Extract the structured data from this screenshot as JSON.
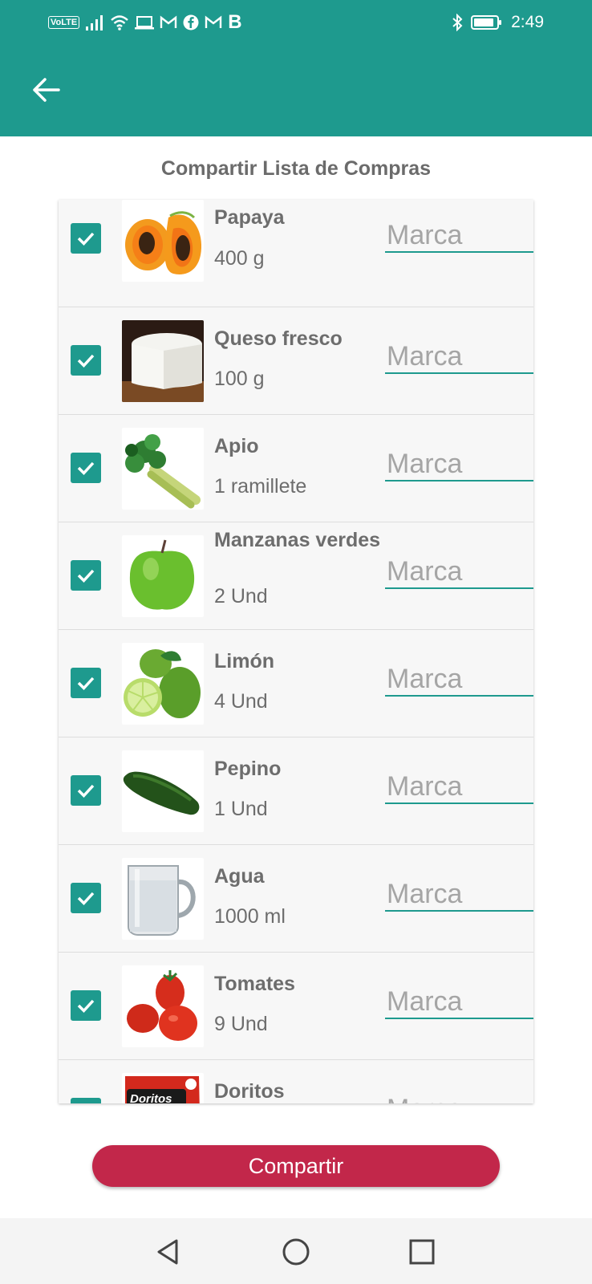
{
  "status_bar": {
    "volte": "VoLTE",
    "carrier_letter": "B",
    "time": "2:49",
    "icons_left": [
      "signal-icon",
      "wifi-icon",
      "laptop-icon",
      "gmail-icon",
      "facebook-icon",
      "gmail-icon",
      "b-app-icon"
    ],
    "icons_right": [
      "bluetooth-icon",
      "battery-icon"
    ]
  },
  "app_bar": {
    "back_icon": "back-arrow-icon",
    "color": "#1e9a8e"
  },
  "page": {
    "title": "Compartir Lista de Compras"
  },
  "colors": {
    "accent": "#1e9a8e",
    "share_button": "#c2274a",
    "text": "#6d6d6d"
  },
  "items": [
    {
      "name": "Papaya",
      "quantity": "400 g",
      "checked": true,
      "brand_placeholder": "Marca",
      "image": "papaya-image"
    },
    {
      "name": "Queso fresco",
      "quantity": "100 g",
      "checked": true,
      "brand_placeholder": "Marca",
      "image": "cheese-image"
    },
    {
      "name": "Apio",
      "quantity": "1 ramillete",
      "checked": true,
      "brand_placeholder": "Marca",
      "image": "celery-image"
    },
    {
      "name": "Manzanas verdes",
      "quantity": "2 Und",
      "checked": true,
      "brand_placeholder": "Marca",
      "image": "green-apple-image"
    },
    {
      "name": "Limón",
      "quantity": "4 Und",
      "checked": true,
      "brand_placeholder": "Marca",
      "image": "lime-image"
    },
    {
      "name": "Pepino",
      "quantity": "1 Und",
      "checked": true,
      "brand_placeholder": "Marca",
      "image": "cucumber-image"
    },
    {
      "name": "Agua",
      "quantity": "1000 ml",
      "checked": true,
      "brand_placeholder": "Marca",
      "image": "water-mug-image"
    },
    {
      "name": "Tomates",
      "quantity": "9 Und",
      "checked": true,
      "brand_placeholder": "Marca",
      "image": "tomatoes-image"
    },
    {
      "name": "Doritos",
      "quantity": "",
      "checked": true,
      "brand_placeholder": "Marca",
      "image": "doritos-image",
      "logo_text": "Doritos"
    }
  ],
  "share_button": {
    "label": "Compartir"
  },
  "nav_bar": {
    "icons": [
      "back-triangle-icon",
      "home-circle-icon",
      "recents-square-icon"
    ]
  }
}
